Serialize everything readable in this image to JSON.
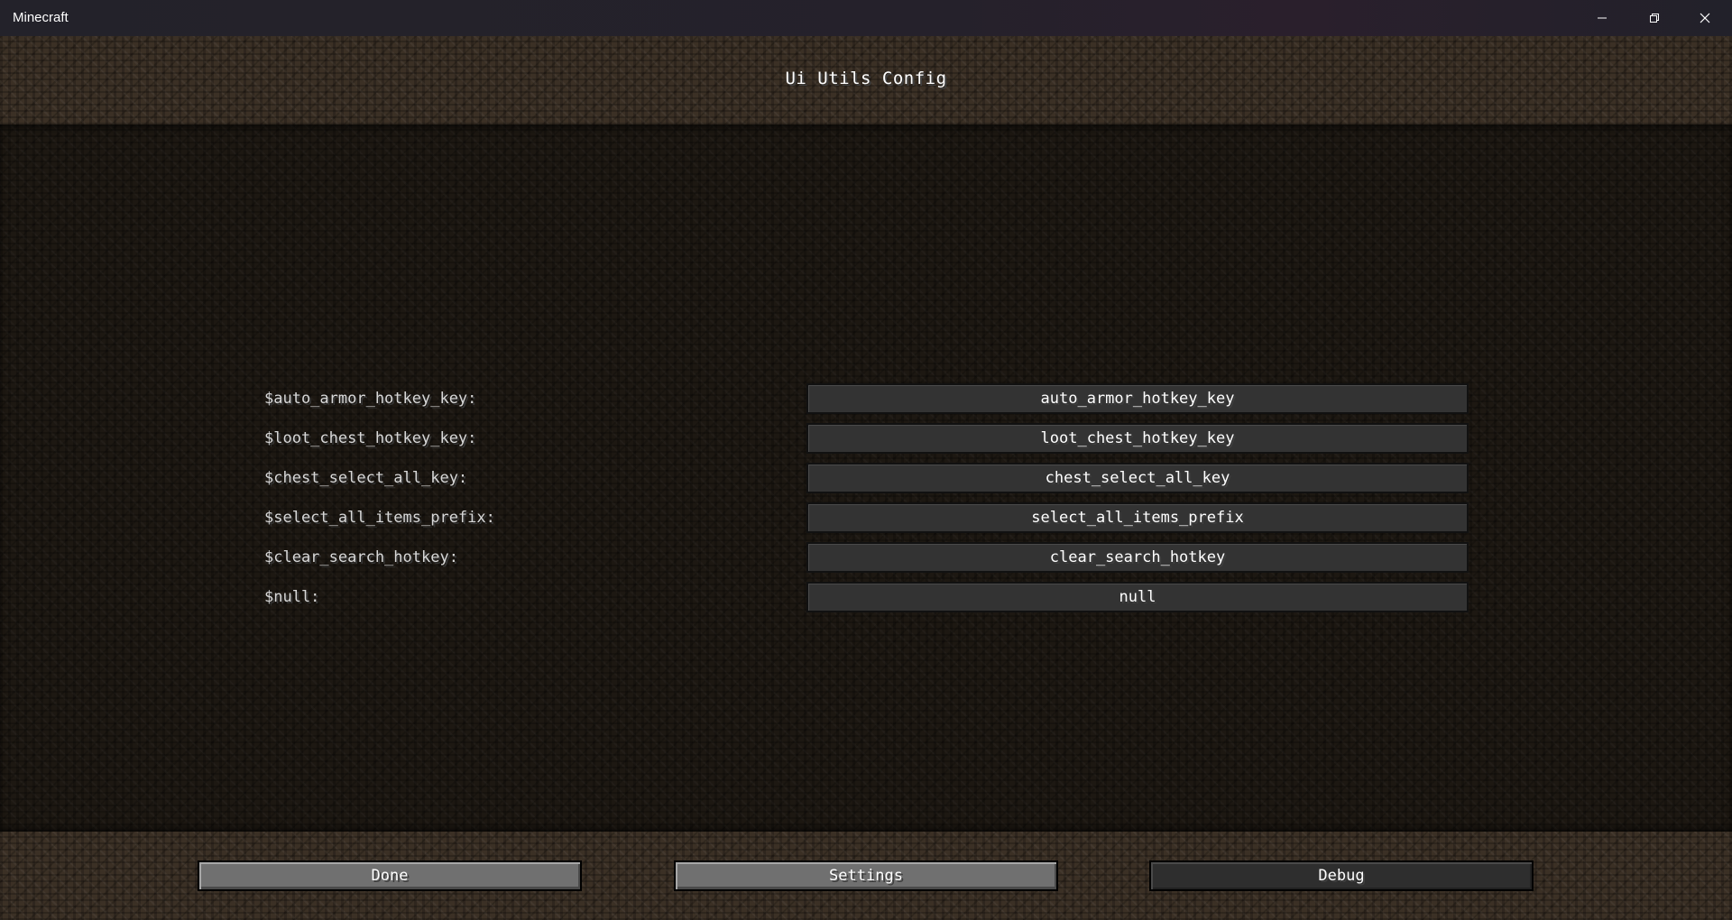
{
  "window": {
    "title": "Minecraft",
    "controls": {
      "minimize_icon": "minimize-icon",
      "restore_icon": "restore-icon",
      "close_icon": "close-icon"
    }
  },
  "screen": {
    "title": "Ui Utils Config"
  },
  "config_rows": [
    {
      "label": "$auto_armor_hotkey_key:",
      "value": "auto_armor_hotkey_key"
    },
    {
      "label": "$loot_chest_hotkey_key:",
      "value": "loot_chest_hotkey_key"
    },
    {
      "label": "$chest_select_all_key:",
      "value": "chest_select_all_key"
    },
    {
      "label": "$select_all_items_prefix:",
      "value": "select_all_items_prefix"
    },
    {
      "label": "$clear_search_hotkey:",
      "value": "clear_search_hotkey"
    },
    {
      "label": "$null:",
      "value": "null"
    }
  ],
  "buttons": {
    "done": "Done",
    "settings": "Settings",
    "debug": "Debug"
  },
  "colors": {
    "title_bar": "#23222a",
    "dirt_header": "#3b3025",
    "dirt_list": "#1d1812",
    "field_bg": "#333333",
    "button_light": "#707070",
    "button_dark": "#2e2e2e"
  }
}
